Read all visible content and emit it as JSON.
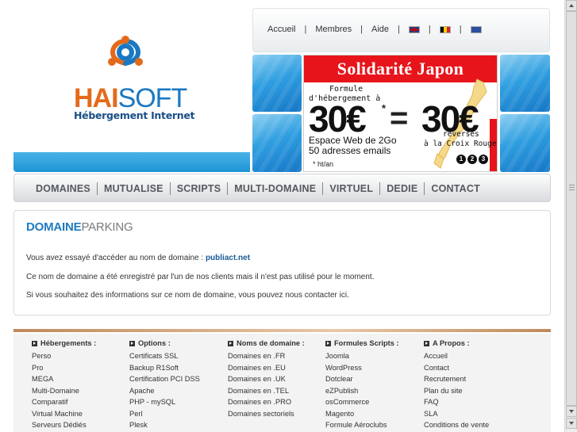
{
  "header": {
    "logo_hai": "HAI",
    "logo_soft": "SOFT",
    "logo_tagline": "Hébergement Internet"
  },
  "topnav": {
    "items": [
      "Accueil",
      "Membres",
      "Aide"
    ],
    "flags": [
      "uk-flag-icon",
      "belgium-flag-icon",
      "eu-flag-icon"
    ]
  },
  "banner": {
    "title": "Solidarité Japon",
    "line1": "Formule",
    "line2": "d'hébergement à",
    "price_left": "30€",
    "star": "*",
    "equals": "=",
    "price_right": "30€",
    "reverses": "reversés",
    "croix": "à la Croix Rouge",
    "space": "Espace Web de 2Go",
    "emails": "50 adresses emails",
    "ht": "* ht/an",
    "dots": [
      "1",
      "2",
      "3"
    ]
  },
  "mainnav": {
    "items": [
      "DOMAINES",
      "MUTUALISE",
      "SCRIPTS",
      "MULTI-DOMAINE",
      "VIRTUEL",
      "DEDIE",
      "CONTACT"
    ]
  },
  "content": {
    "title_bold": "DOMAINE",
    "title_light": "PARKING",
    "p1_prefix": "Vous avez essayé d'accéder au nom de domaine : ",
    "p1_domain": "publiact.net",
    "p2": "Ce nom de domaine a été enregistré par l'un de nos clients mais il n'est pas utilisé pour le moment.",
    "p3": "Si vous souhaitez des informations sur ce nom de domaine, vous pouvez nous contacter ici."
  },
  "footer": {
    "columns": [
      {
        "head": "Hébergements :",
        "links": [
          "Perso",
          "Pro",
          "MEGA",
          "Multi-Domaine",
          "Comparatif",
          "Virtual Machine",
          "Serveurs Dédiés"
        ]
      },
      {
        "head": "Options :",
        "links": [
          "Certificats SSL",
          "Backup R1Soft",
          "Certification PCI DSS",
          "Apache",
          "PHP - mySQL",
          "Perl",
          "Plesk"
        ]
      },
      {
        "head": "Noms de domaine :",
        "links": [
          "Domaines en .FR",
          "Domaines en .EU",
          "Domaines en .UK",
          "Domaines en .TEL",
          "Domaines en .PRO",
          "Domaines sectoriels"
        ]
      },
      {
        "head": "Formules Scripts :",
        "links": [
          "Joomla",
          "WordPress",
          "Dotclear",
          "eZPublish",
          "osCommerce",
          "Magento",
          "Formule Aéroclubs"
        ]
      },
      {
        "head": "A Propos :",
        "links": [
          "Accueil",
          "Contact",
          "Recrutement",
          "Plan du site",
          "FAQ",
          "SLA",
          "Conditions de vente"
        ]
      }
    ]
  },
  "colors": {
    "brand_orange": "#e46a1a",
    "brand_blue": "#1a78c2",
    "banner_red": "#e8141b",
    "title_blue": "#1f7bc0"
  }
}
